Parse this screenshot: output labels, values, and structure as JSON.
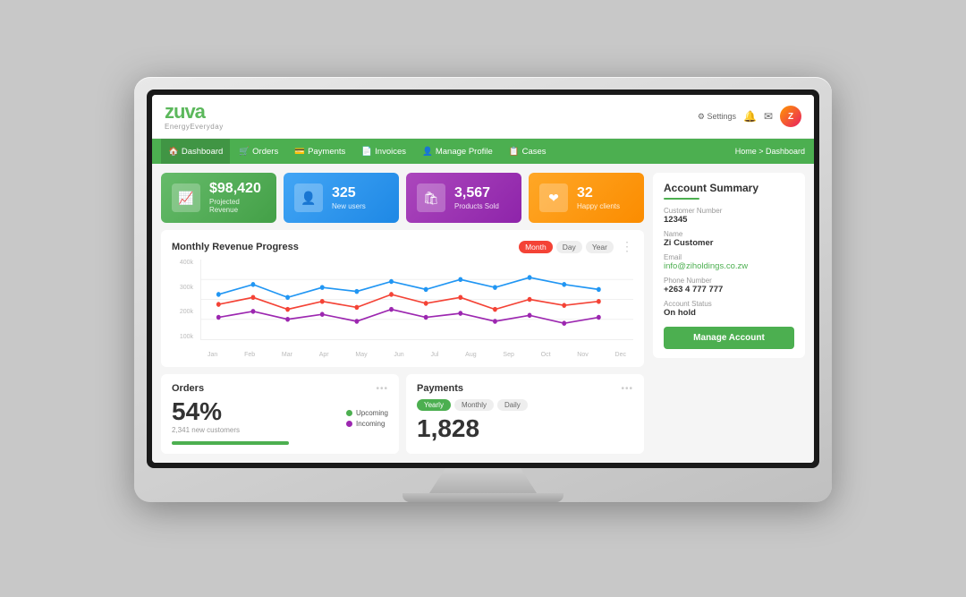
{
  "app": {
    "logo": "zuva",
    "logo_sub": "EnergyEveryday",
    "settings_label": "Settings",
    "breadcrumb": "Home > Dashboard"
  },
  "nav": {
    "items": [
      {
        "icon": "🏠",
        "label": "Dashboard",
        "active": true
      },
      {
        "icon": "🛒",
        "label": "Orders"
      },
      {
        "icon": "💳",
        "label": "Payments"
      },
      {
        "icon": "📄",
        "label": "Invoices"
      },
      {
        "icon": "👤",
        "label": "Manage Profile"
      },
      {
        "icon": "📋",
        "label": "Cases"
      }
    ]
  },
  "stats": [
    {
      "id": "revenue",
      "color": "green",
      "icon": "📈",
      "value": "$98,420",
      "label": "Projected Revenue"
    },
    {
      "id": "users",
      "color": "blue",
      "icon": "👤",
      "value": "325",
      "label": "New users"
    },
    {
      "id": "products",
      "color": "purple",
      "icon": "🛍",
      "value": "3,567",
      "label": "Products Sold"
    },
    {
      "id": "clients",
      "color": "orange",
      "icon": "❤",
      "value": "32",
      "label": "Happy clients"
    }
  ],
  "chart": {
    "title": "Monthly Revenue Progress",
    "y_labels": [
      "400k",
      "300k",
      "200k",
      "100k"
    ],
    "x_labels": [
      "Jan",
      "Feb",
      "Mar",
      "Apr",
      "May",
      "Jun",
      "Jul",
      "Aug",
      "Sep",
      "Oct",
      "Nov",
      "Dec"
    ],
    "period_buttons": [
      "Month",
      "Day",
      "Year"
    ],
    "active_period": "Month"
  },
  "orders_card": {
    "title": "Orders",
    "percent": "54%",
    "sub_label": "2,341 new customers",
    "legend": [
      {
        "color": "#4caf50",
        "label": "Upcoming"
      },
      {
        "color": "#9c27b0",
        "label": "Incoming"
      }
    ]
  },
  "payments_card": {
    "title": "Payments",
    "tabs": [
      "Yearly",
      "Monthly",
      "Daily"
    ],
    "active_tab": "Yearly",
    "value": "1,828"
  },
  "account_summary": {
    "title": "Account Summary",
    "fields": [
      {
        "label": "Customer Number",
        "value": "12345",
        "type": "normal"
      },
      {
        "label": "Name",
        "value": "Zi Customer",
        "type": "normal"
      },
      {
        "label": "Email",
        "value": "info@ziholdings.co.zw",
        "type": "email"
      },
      {
        "label": "Phone Number",
        "value": "+263 4 777 777",
        "type": "normal"
      },
      {
        "label": "Account Status",
        "value": "On hold",
        "type": "normal"
      }
    ],
    "manage_button": "Manage Account"
  }
}
